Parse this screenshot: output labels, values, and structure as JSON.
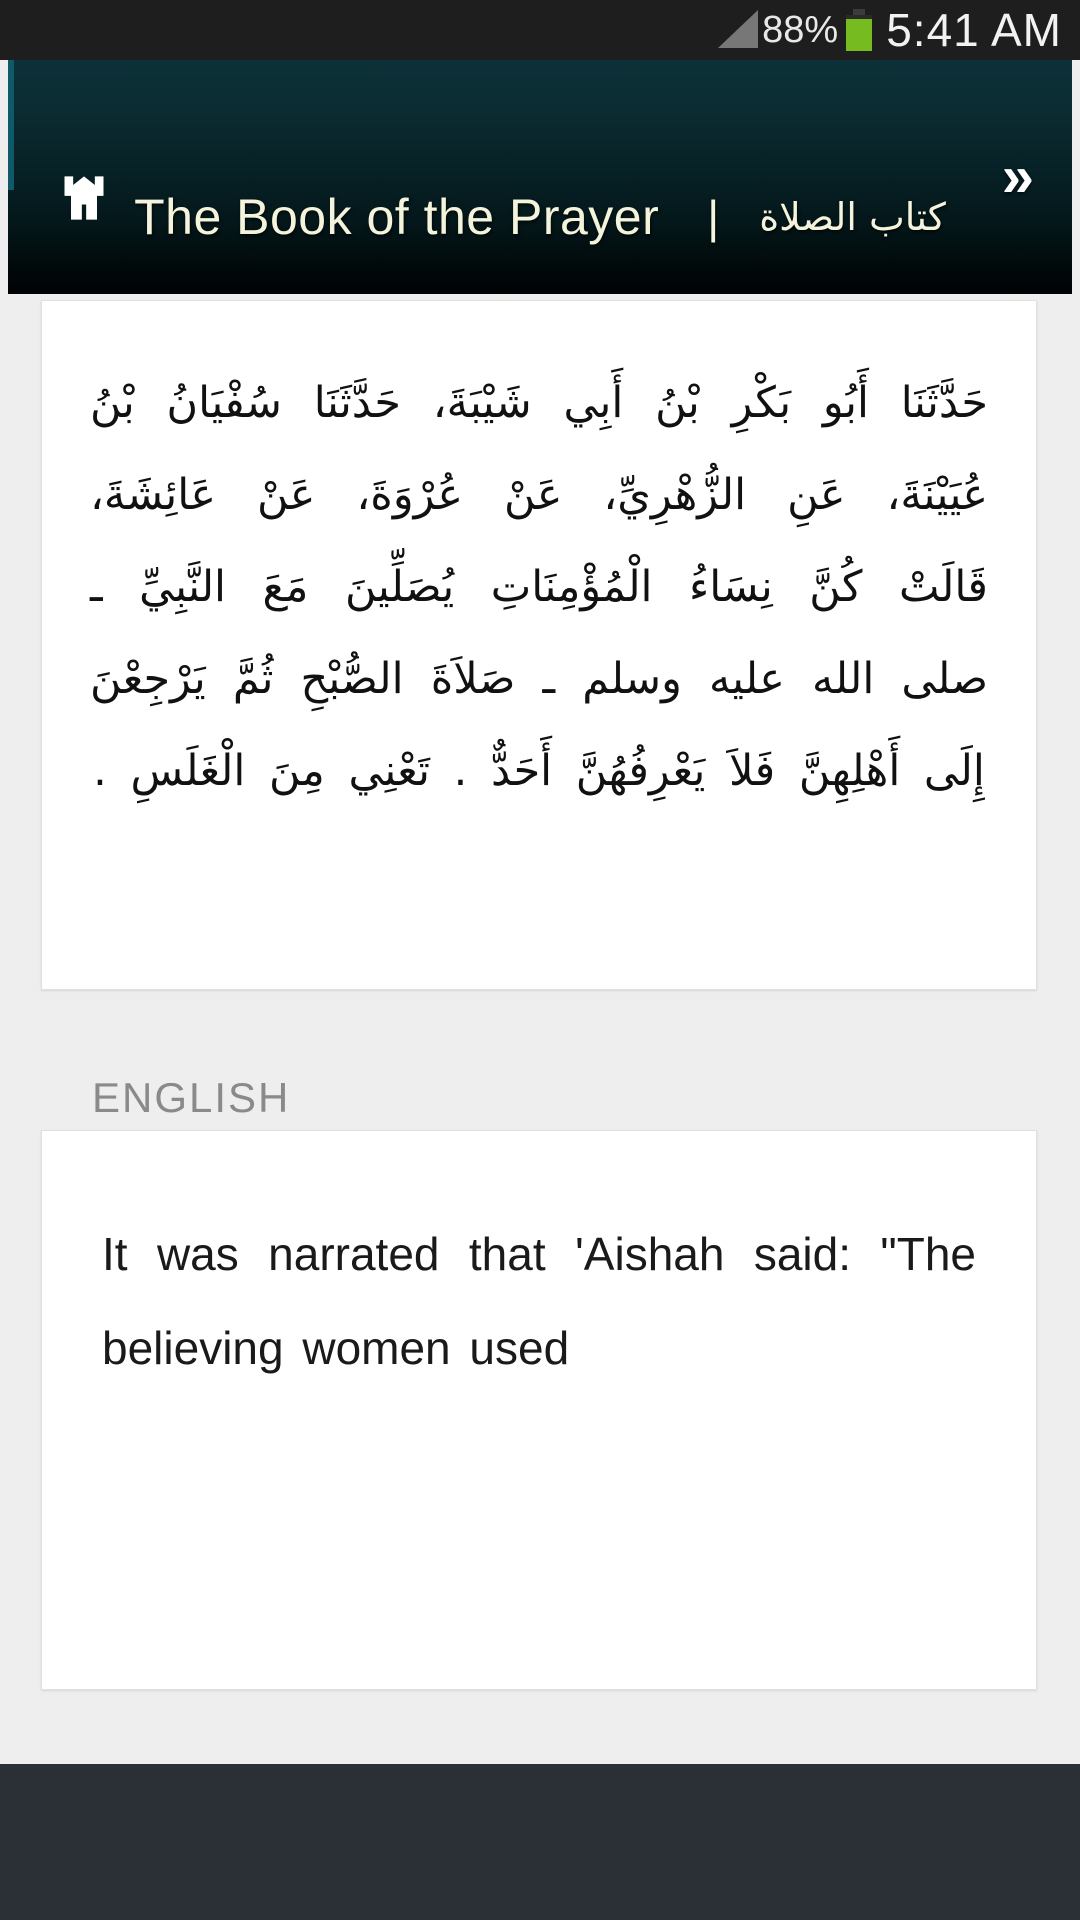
{
  "status_bar": {
    "signal_icon": "signal-triangle-icon",
    "battery_percent": "88%",
    "battery_icon": "battery-icon",
    "clock": "5:41 AM"
  },
  "header": {
    "home_icon": "home-icon",
    "overflow_label": "»",
    "title_en": "The Book of the Prayer",
    "separator": "|",
    "title_ar": "كتاب الصلاة",
    "accent_color": "#0e5a68",
    "title_color": "#f4f3dc"
  },
  "content": {
    "arabic_text": "حَدَّثَنَا أَبُو بَكْرِ بْنُ أَبِي شَيْبَةَ، حَدَّثَنَا سُفْيَانُ بْنُ عُيَيْنَةَ، عَنِ الزُّهْرِيِّ، عَنْ عُرْوَةَ، عَنْ عَائِشَةَ، قَالَتْ كُنَّ نِسَاءُ الْمُؤْمِنَاتِ يُصَلِّينَ مَعَ النَّبِيِّ ـ صلى الله عليه وسلم ـ صَلاَةَ الصُّبْحِ ثُمَّ يَرْجِعْنَ إِلَى أَهْلِهِنَّ فَلاَ يَعْرِفُهُنَّ أَحَدٌّ . تَعْنِي مِنَ الْغَلَسِ .",
    "english_section_label": "ENGLISH",
    "english_text": "It was narrated that 'Aishah said: \"The believing women used"
  }
}
